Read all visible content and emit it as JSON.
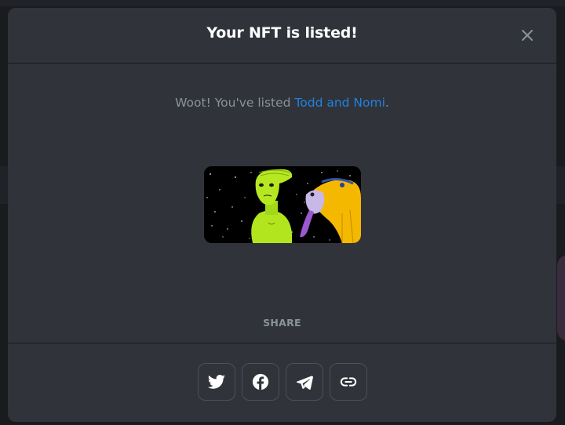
{
  "modal": {
    "title": "Your NFT is listed!",
    "message_prefix": "Woot! You've listed ",
    "item_name": "Todd and Nomi",
    "message_suffix": ".",
    "share_label": "SHARE"
  },
  "icons": {
    "close": "close-icon",
    "twitter": "twitter-icon",
    "facebook": "facebook-icon",
    "telegram": "telegram-icon",
    "link": "link-icon"
  },
  "colors": {
    "modal_bg": "#303339",
    "link": "#2081e2",
    "muted_text": "#8a939b",
    "title": "#ffffff",
    "button_border": "#4c505c"
  }
}
